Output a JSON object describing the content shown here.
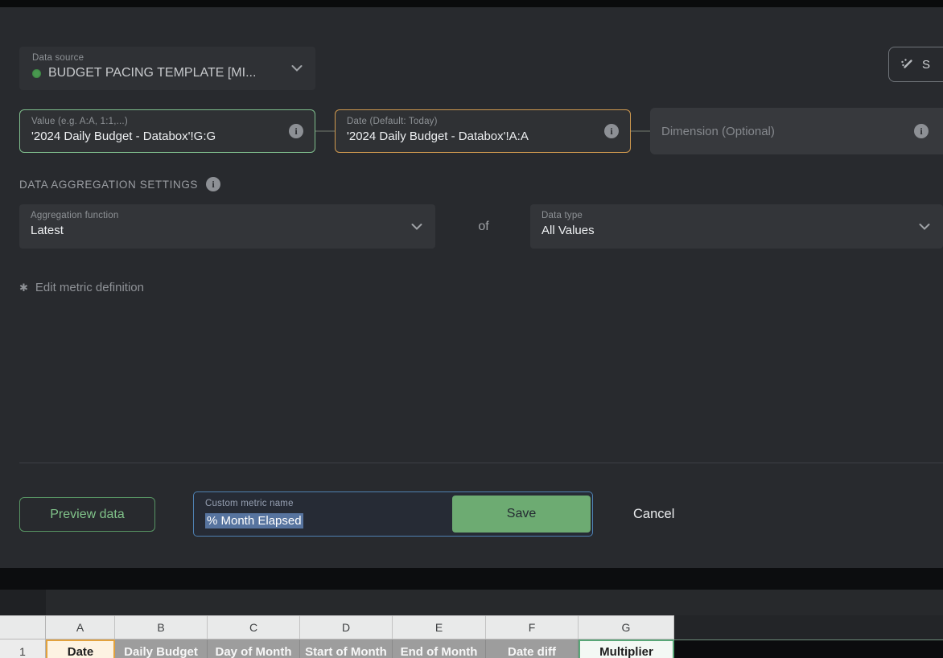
{
  "modal": {
    "data_source": {
      "label": "Data source",
      "value": "BUDGET PACING TEMPLATE [MI..."
    },
    "suggest_button_label": "S",
    "fields": {
      "value": {
        "label": "Value (e.g. A:A, 1:1,...)",
        "value": "'2024 Daily Budget - Databox'!G:G"
      },
      "date": {
        "label": "Date (Default: Today)",
        "value": "'2024 Daily Budget - Databox'!A:A"
      },
      "dimension": {
        "placeholder": "Dimension (Optional)"
      }
    },
    "aggregation": {
      "section_title": "DATA AGGREGATION SETTINGS",
      "function": {
        "label": "Aggregation function",
        "value": "Latest"
      },
      "of_label": "of",
      "data_type": {
        "label": "Data type",
        "value": "All Values"
      }
    },
    "edit_metric_definition_label": "Edit metric definition",
    "footer": {
      "preview_label": "Preview data",
      "metric_name": {
        "label": "Custom metric name",
        "value": "% Month Elapsed"
      },
      "save_label": "Save",
      "cancel_label": "Cancel"
    }
  },
  "spreadsheet": {
    "row_number": "1",
    "columns": [
      {
        "letter": "A",
        "header": "Date",
        "state": "selected-date"
      },
      {
        "letter": "B",
        "header": "Daily Budget",
        "state": "normal"
      },
      {
        "letter": "C",
        "header": "Day of Month",
        "state": "normal"
      },
      {
        "letter": "D",
        "header": "Start of Month",
        "state": "normal"
      },
      {
        "letter": "E",
        "header": "End of Month",
        "state": "normal"
      },
      {
        "letter": "F",
        "header": "Date diff",
        "state": "normal"
      },
      {
        "letter": "G",
        "header": "Multiplier",
        "state": "selected-value"
      }
    ]
  },
  "colors": {
    "value_border": "#7fbe8d",
    "date_border": "#d0994f",
    "name_border": "#4e81b2",
    "selection": "#57749f",
    "save_green": "#6dab72",
    "preview_green": "#80c289",
    "source_dot": "#49984f",
    "a1_bg": "#fdf3e2",
    "a1_border": "#e2a23d",
    "g1_border": "#58a677"
  }
}
